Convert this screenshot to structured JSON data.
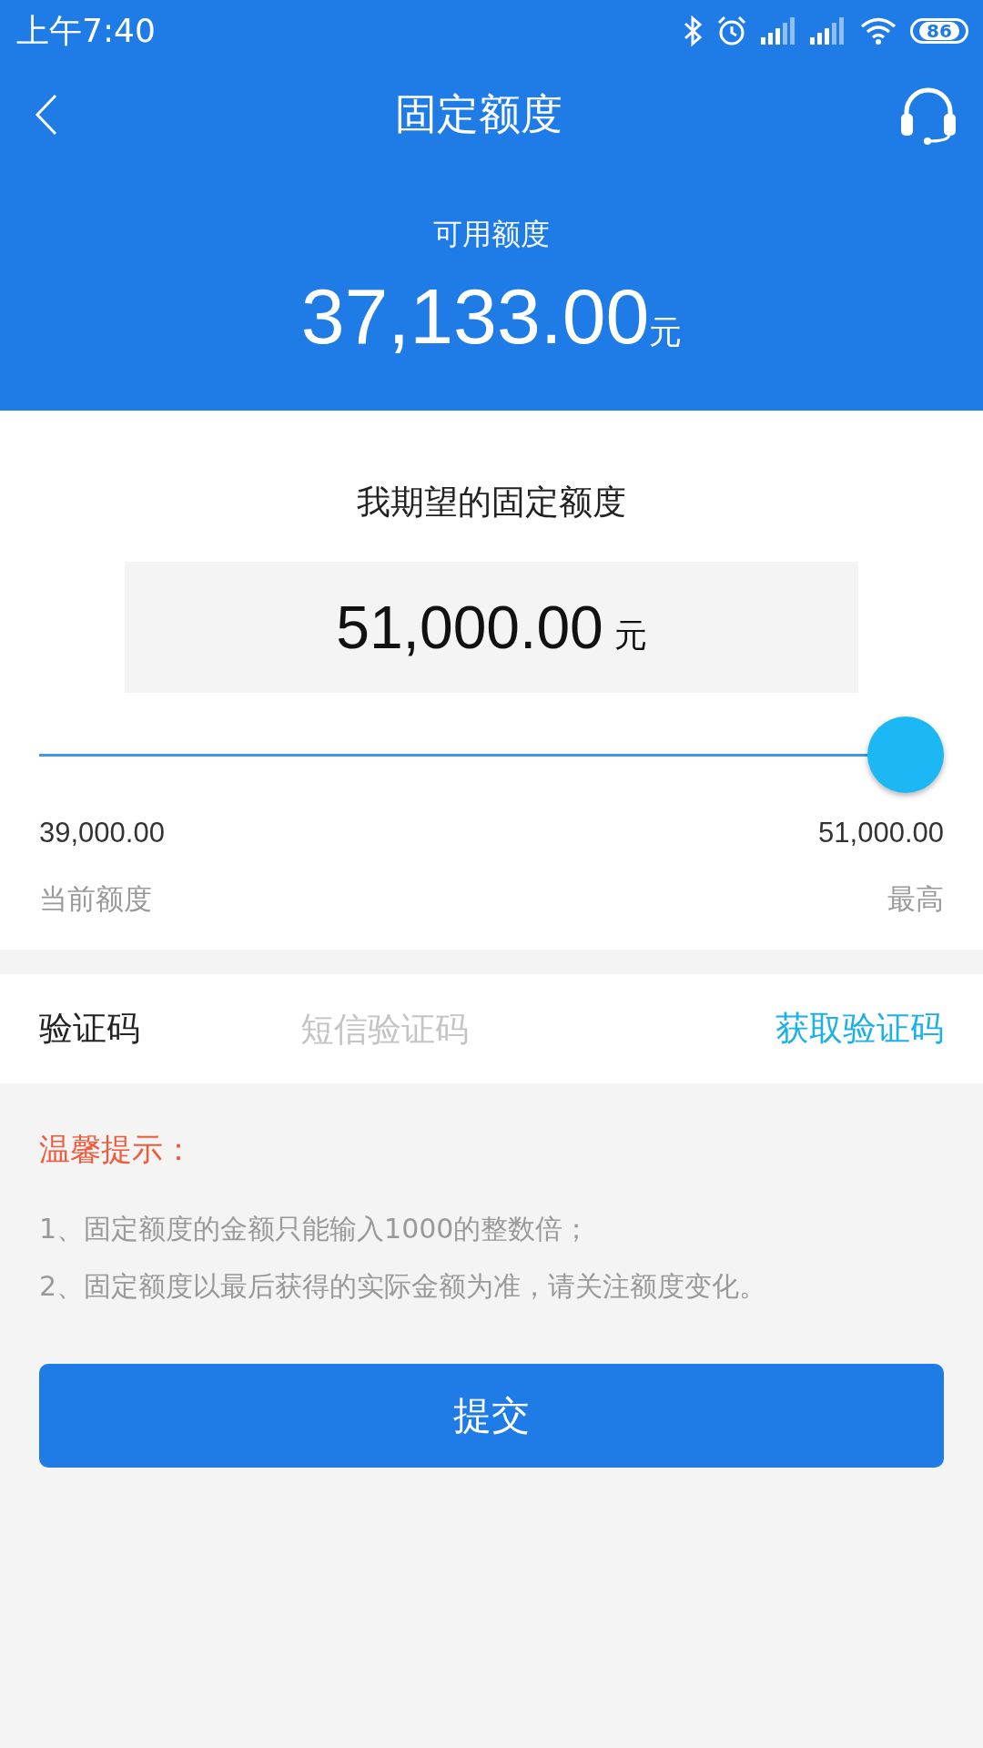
{
  "status_bar": {
    "time": "上午7:40",
    "battery": "86"
  },
  "nav": {
    "title": "固定额度"
  },
  "available": {
    "label": "可用额度",
    "amount": "37,133.00",
    "unit": "元"
  },
  "expected": {
    "title": "我期望的固定额度",
    "amount": "51,000.00",
    "unit": "元"
  },
  "slider": {
    "level": 1.0,
    "min_value": "39,000.00",
    "max_value": "51,000.00",
    "min_label": "当前额度",
    "max_label": "最高"
  },
  "verification": {
    "label": "验证码",
    "placeholder": "短信验证码",
    "action": "获取验证码"
  },
  "tips": {
    "title": "温馨提示：",
    "lines": [
      "1、固定额度的金额只能输入1000的整数倍；",
      "2、固定额度以最后获得的实际金额为准，请关注额度变化。"
    ]
  },
  "submit": "提交"
}
